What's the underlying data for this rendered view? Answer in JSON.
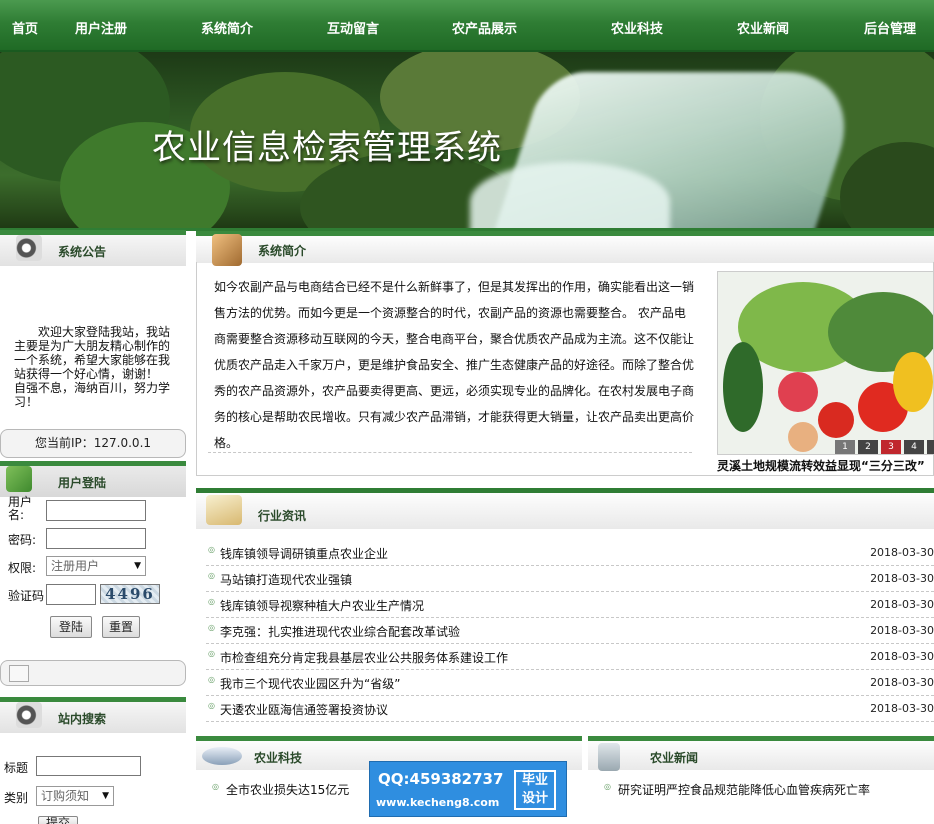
{
  "nav": {
    "items": [
      "首页",
      "用户注册",
      "系统简介",
      "互动留言",
      "农产品展示",
      "农业科技",
      "农业新闻",
      "后台管理"
    ]
  },
  "banner": {
    "title": "农业信息检索管理系统"
  },
  "sidebar": {
    "notice": {
      "title": "系统公告",
      "text": "　　欢迎大家登陆我站，我站主要是为广大朋友精心制作的一个系统，希望大家能够在我站获得一个好心情，谢谢！　　自强不息，海纳百川，努力学习！"
    },
    "ip": "您当前IP：127.0.0.1",
    "login": {
      "title": "用户登陆",
      "username_label": "用户名:",
      "password_label": "密码:",
      "role_label": "权限:",
      "role_value": "注册用户",
      "captcha_label": "验证码",
      "captcha_value": "4496",
      "login_button": "登陆",
      "reset_button": "重置"
    },
    "search": {
      "title": "站内搜索",
      "title_label": "标题",
      "type_label": "类别",
      "type_value": "订购须知",
      "submit_button": "提交"
    }
  },
  "intro": {
    "title": "系统简介",
    "text": "如今农副产品与电商结合已经不是什么新鲜事了，但是其发挥出的作用，确实能看出这一销售方法的优势。而如今更是一个资源整合的时代，农副产品的资源也需要整合。 农产品电商需要整合资源移动互联网的今天，整合电商平台，聚合优质农产品成为主流。这不仅能让优质农产品走入千家万户，更是维护食品安全、推广生态健康产品的好途径。而除了整合优秀的农产品资源外，农产品要卖得更高、更远，必须实现专业的品牌化。在农村发展电子商务的核心是帮助农民增收。只有减少农产品滞销，才能获得更大销量，让农产品卖出更高价格。",
    "slideshow_caption": "灵溪土地规模流转效益显现“三分三改”",
    "slideshow_pages": [
      "1",
      "2",
      "3",
      "4",
      "5"
    ]
  },
  "industry": {
    "title": "行业资讯",
    "items": [
      {
        "title": "钱库镇领导调研镇重点农业企业",
        "date": "2018-03-30"
      },
      {
        "title": "马站镇打造现代农业强镇",
        "date": "2018-03-30"
      },
      {
        "title": "钱库镇领导视察种植大户农业生产情况",
        "date": "2018-03-30"
      },
      {
        "title": "李克强：扎实推进现代农业综合配套改革试验",
        "date": "2018-03-30"
      },
      {
        "title": "市检查组充分肯定我县基层农业公共服务体系建设工作",
        "date": "2018-03-30"
      },
      {
        "title": "我市三个现代农业园区升为“省级”",
        "date": "2018-03-30"
      },
      {
        "title": "天逶农业瓯海信通签署投资协议",
        "date": "2018-03-30"
      }
    ]
  },
  "tech": {
    "title": "农业科技",
    "items": [
      "全市农业损失达15亿元"
    ]
  },
  "agnews": {
    "title": "农业新闻",
    "items": [
      "研究证明严控食品规范能降低心血管疾病死亡率"
    ]
  },
  "watermark": {
    "qq": "QQ:459382737",
    "site": "www.kecheng8.com",
    "badge": "毕业设计"
  }
}
